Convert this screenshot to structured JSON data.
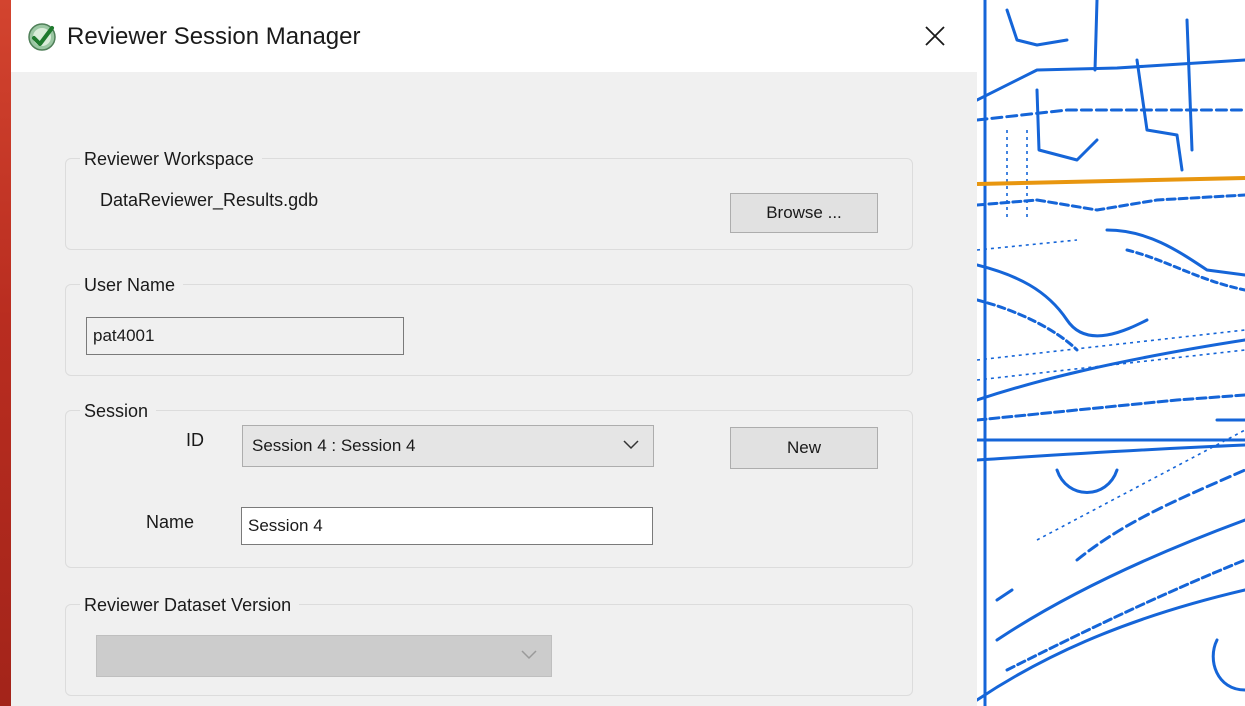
{
  "window": {
    "title": "Reviewer Session Manager",
    "icon": "green-checkmark-icon",
    "close_icon": "close-icon"
  },
  "workspace": {
    "legend": "Reviewer Workspace",
    "path": "DataReviewer_Results.gdb",
    "browse_label": "Browse ..."
  },
  "user": {
    "legend": "User Name",
    "value": "pat4001"
  },
  "session": {
    "legend": "Session",
    "id_label": "ID",
    "id_selected": "Session 4 : Session 4",
    "new_label": "New",
    "name_label": "Name",
    "name_value": "Session 4"
  },
  "dataset_version": {
    "legend": "Reviewer Dataset Version",
    "selected": ""
  },
  "colors": {
    "desktop_bg": "#c0392b",
    "dialog_bg": "#f0f0f0",
    "map_line": "#1565d8",
    "map_highlight": "#e8960f"
  }
}
